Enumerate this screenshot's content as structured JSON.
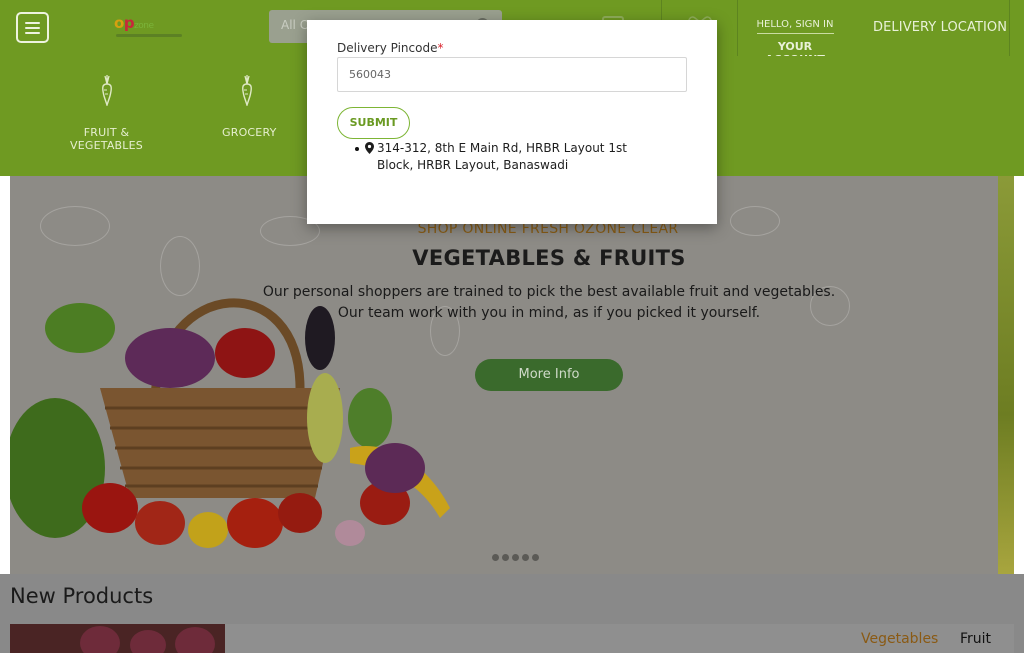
{
  "header": {
    "logo_o": "o",
    "logo_p": "p",
    "logo_rest": "zone",
    "search_placeholder": "All C",
    "account_greeting": "HELLO, SIGN IN",
    "account_label": "YOUR ACCOUNT",
    "delivery_location": "DELIVERY LOCATION"
  },
  "categories": [
    {
      "label": "FRUIT & VEGETABLES",
      "icon": "carrot-icon"
    },
    {
      "label": "GROCERY",
      "icon": "carrot-icon"
    }
  ],
  "banner": {
    "kicker": "SHOP ONLINE FRESH OZONE CLEAR",
    "headline": "VEGETABLES & FRUITS",
    "description": "Our personal shoppers are trained to pick the best available fruit and vegetables. Our team work with you in mind, as if you picked it yourself.",
    "cta": "More Info"
  },
  "new_products": {
    "title": "New Products",
    "tabs": [
      "Vegetables",
      "Fruit"
    ]
  },
  "modal": {
    "field_label": "Delivery Pincode",
    "required_mark": "*",
    "pincode_value": "560043",
    "submit": "SUBMIT",
    "addresses": [
      {
        "line": "314-312, 8th E Main Rd, HRBR Layout 1st Block, HRBR Layout, Banaswadi"
      }
    ]
  },
  "colors": {
    "brand_green": "#6f9a22",
    "submit_green": "#7db535",
    "cta_green": "#3a6a2c",
    "required_red": "#d9232d"
  }
}
